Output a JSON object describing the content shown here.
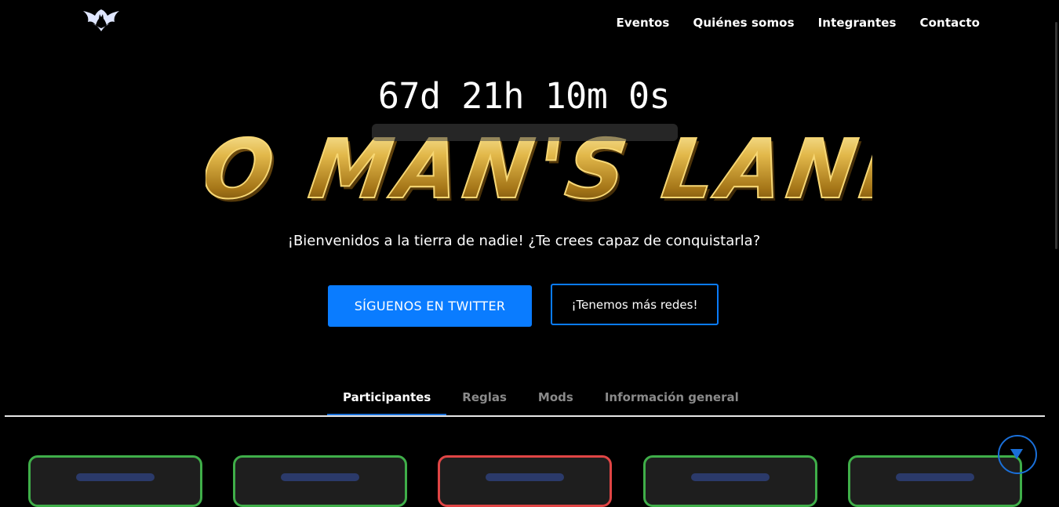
{
  "header": {
    "logo_icon": "bat-logo-icon",
    "nav": [
      "Eventos",
      "Quiénes somos",
      "Integrantes",
      "Contacto"
    ]
  },
  "hero": {
    "countdown": "67d 21h 10m 0s",
    "title_logo_text": "NO MAN'S LAND",
    "tagline": "¡Bienvenidos a la tierra de nadie! ¿Te crees capaz de conquistarla?",
    "primary_button": "SÍGUENOS EN TWITTER",
    "secondary_button": "¡Tenemos más redes!"
  },
  "tabs": [
    "Participantes",
    "Reglas",
    "Mods",
    "Información general"
  ],
  "active_tab": "Participantes",
  "cards": [
    {
      "status_color": "#3fae49"
    },
    {
      "status_color": "#3fae49"
    },
    {
      "status_color": "#e04545"
    },
    {
      "status_color": "#3fae49"
    },
    {
      "status_color": "#3fae49"
    }
  ],
  "colors": {
    "accent": "#0a7cff",
    "background": "#000000",
    "gold": "#c9a233"
  }
}
